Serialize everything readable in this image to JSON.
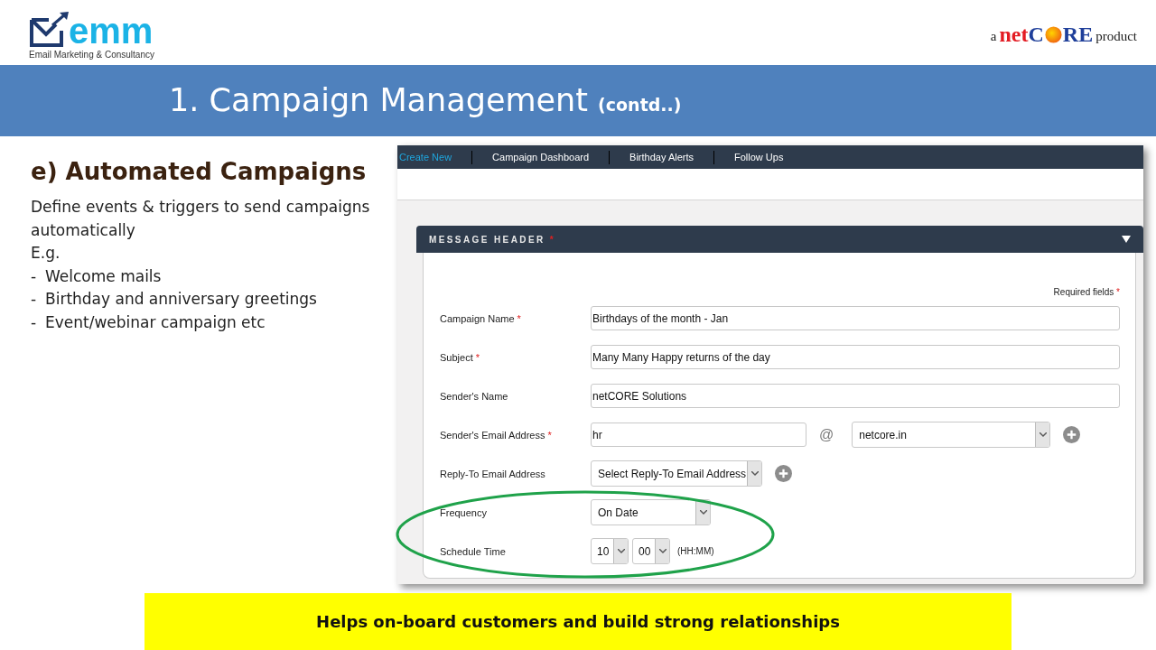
{
  "logo": {
    "word": "emm",
    "tagline": "Email Marketing & Consultancy"
  },
  "partner": {
    "prefix": "a",
    "brand_start": "netC",
    "brand_end": "RE",
    "suffix": "product"
  },
  "slide_title": {
    "text": "1. Campaign Management",
    "suffix": "(contd..)"
  },
  "content": {
    "heading": "e) Automated Campaigns",
    "lines": [
      "Define events & triggers to send campaigns automatically",
      "E.g."
    ],
    "bullets": [
      {
        "dash": "-",
        "text": "Welcome mails"
      },
      {
        "dash": "-",
        "text": "Birthday and anniversary greetings"
      },
      {
        "dash": "-",
        "text": "Event/webinar campaign etc"
      }
    ]
  },
  "app": {
    "nav": [
      {
        "label": "Create New",
        "selected": true
      },
      {
        "label": "Campaign Dashboard",
        "selected": false
      },
      {
        "label": "Birthday Alerts",
        "selected": false
      },
      {
        "label": "Follow Ups",
        "selected": false
      }
    ],
    "section": {
      "title": "MESSAGE HEADER",
      "mark": "*",
      "expanded": true
    },
    "required_note": {
      "text": "Required fields",
      "mark": "*"
    },
    "rows": [
      {
        "kind": "text",
        "label": "Campaign Name",
        "mark": "*",
        "value": "Birthdays of the month - Jan"
      },
      {
        "kind": "text",
        "label": "Subject",
        "mark": "*",
        "value": "Many Many Happy returns of the day"
      },
      {
        "kind": "text",
        "label": "Sender's Name",
        "value": "netCORE Solutions"
      },
      {
        "kind": "email",
        "label": "Sender's Email Address",
        "mark": "*",
        "value": "hr",
        "at": "@",
        "domain": "netcore.in"
      },
      {
        "kind": "select",
        "label": "Reply-To Email Address",
        "value": "Select Reply-To Email Address",
        "addable": true
      },
      {
        "kind": "select",
        "label": "Frequency",
        "value": "On Date",
        "addable": false
      },
      {
        "kind": "time",
        "label": "Schedule Time",
        "hour": "10",
        "minute": "00",
        "format": "(HH:MM)"
      }
    ]
  },
  "banner": {
    "text": "Helps on-board customers and build strong relationships"
  }
}
